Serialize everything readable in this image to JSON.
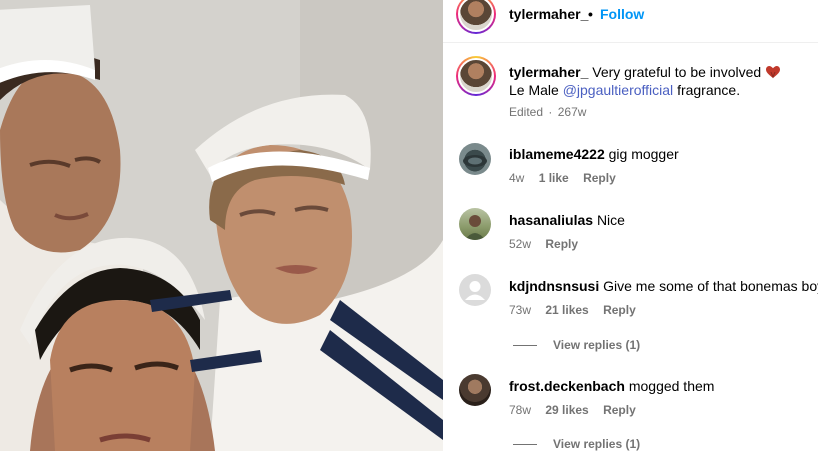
{
  "post": {
    "author": "tylermaher_",
    "separator": "•",
    "follow_label": "Follow"
  },
  "caption": {
    "user": "tylermaher_",
    "text_before_emoji": "Very grateful to be involved",
    "line2_prefix": "Le Male",
    "mention": "@jpgaultierofficial",
    "line2_suffix": "fragrance.",
    "edited": "Edited",
    "dot": "·",
    "age": "267w"
  },
  "comments": [
    {
      "user": "iblameme4222",
      "text": "gig mogger",
      "age": "4w",
      "likes": "1 like",
      "reply_label": "Reply",
      "avatar_color": "#3b4a4c"
    },
    {
      "user": "hasanaliulas",
      "text": "Nice",
      "age": "52w",
      "likes": "",
      "reply_label": "Reply",
      "avatar_color": "#8a9a6a"
    },
    {
      "user": "kdjndnsnsusi",
      "text": "Give me some of that bonemas boy",
      "age": "73w",
      "likes": "21 likes",
      "reply_label": "Reply",
      "view_replies": "View replies (1)",
      "avatar_color": "#dbdbdb"
    },
    {
      "user": "frost.deckenbach",
      "text": "mogged them",
      "age": "78w",
      "likes": "29 likes",
      "reply_label": "Reply",
      "view_replies": "View replies (1)",
      "avatar_color": "#4a3a30"
    }
  ],
  "icons": {
    "heart_emoji": "red-heart-hands-icon",
    "default_avatar": "default-user-icon"
  },
  "colors": {
    "link_blue": "#0095f6",
    "mention_blue": "#4a5fc1",
    "muted": "#737373"
  }
}
